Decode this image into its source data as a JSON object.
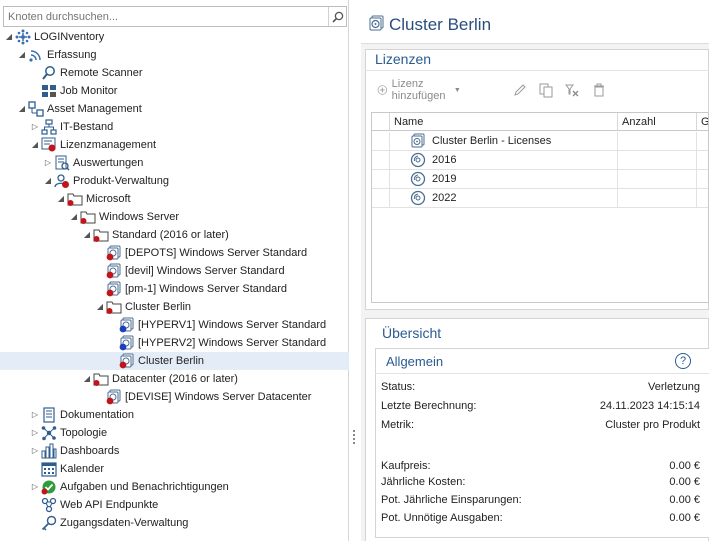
{
  "search": {
    "placeholder": "Knoten durchsuchen..."
  },
  "tree": [
    {
      "label": "LOGINventory",
      "toggle": "expanded",
      "icon": "loginventory-icon"
    },
    {
      "label": "Erfassung",
      "toggle": "expanded",
      "icon": "wifi-icon"
    },
    {
      "label": "Remote Scanner",
      "toggle": "",
      "icon": "magnifier-icon"
    },
    {
      "label": "Job Monitor",
      "toggle": "",
      "icon": "job-monitor-icon"
    },
    {
      "label": "Asset Management",
      "toggle": "expanded",
      "icon": "asset-management-icon"
    },
    {
      "label": "IT-Bestand",
      "toggle": "collapsed",
      "icon": "network-icon"
    },
    {
      "label": "Lizenzmanagement",
      "toggle": "expanded",
      "icon": "license-management-icon"
    },
    {
      "label": "Auswertungen",
      "toggle": "collapsed",
      "icon": "report-icon"
    },
    {
      "label": "Produkt-Verwaltung",
      "toggle": "expanded",
      "icon": "product-management-icon"
    },
    {
      "label": "Microsoft",
      "toggle": "expanded",
      "icon": "folder-icon"
    },
    {
      "label": "Windows Server",
      "toggle": "expanded",
      "icon": "folder-icon"
    },
    {
      "label": "Standard (2016 or later)",
      "toggle": "expanded",
      "icon": "folder-icon"
    },
    {
      "label": "[DEPOTS] Windows Server Standard",
      "toggle": "",
      "icon": "license-red-icon"
    },
    {
      "label": "[devil] Windows Server Standard",
      "toggle": "",
      "icon": "license-red-icon"
    },
    {
      "label": "[pm-1] Windows Server Standard",
      "toggle": "",
      "icon": "license-red-icon"
    },
    {
      "label": "Cluster Berlin",
      "toggle": "expanded",
      "icon": "folder-icon"
    },
    {
      "label": "[HYPERV1] Windows Server Standard",
      "toggle": "",
      "icon": "license-blue-icon"
    },
    {
      "label": "[HYPERV2] Windows Server Standard",
      "toggle": "",
      "icon": "license-blue-icon"
    },
    {
      "label": "Cluster Berlin",
      "toggle": "",
      "icon": "license-red-icon"
    },
    {
      "label": "Datacenter (2016 or later)",
      "toggle": "expanded",
      "icon": "folder-icon"
    },
    {
      "label": "[DEVISE] Windows Server Datacenter",
      "toggle": "",
      "icon": "license-red-icon"
    },
    {
      "label": "Dokumentation",
      "toggle": "collapsed",
      "icon": "document-icon"
    },
    {
      "label": "Topologie",
      "toggle": "collapsed",
      "icon": "topology-icon"
    },
    {
      "label": "Dashboards",
      "toggle": "collapsed",
      "icon": "dashboard-icon"
    },
    {
      "label": "Kalender",
      "toggle": "",
      "icon": "calendar-icon"
    },
    {
      "label": "Aufgaben und Benachrichtigungen",
      "toggle": "collapsed",
      "icon": "tasks-icon"
    },
    {
      "label": "Web API Endpunkte",
      "toggle": "",
      "icon": "web-api-icon"
    },
    {
      "label": "Zugangsdaten-Verwaltung",
      "toggle": "",
      "icon": "key-icon"
    }
  ],
  "header": {
    "title": "Cluster Berlin"
  },
  "licenses": {
    "title": "Lizenzen",
    "add_label": "Lizenz hinzufügen",
    "columns": [
      "Name",
      "Anzahl",
      "Gü"
    ],
    "rows": [
      {
        "name": "Cluster Berlin - Licenses",
        "icon": "license-group-icon"
      },
      {
        "name": "2016",
        "icon": "disc-icon"
      },
      {
        "name": "2019",
        "icon": "disc-icon"
      },
      {
        "name": "2022",
        "icon": "disc-icon"
      }
    ]
  },
  "overview": {
    "title": "Übersicht",
    "section": "Allgemein",
    "help": "?",
    "items": [
      {
        "key": "Status:",
        "value": "Verletzung"
      },
      {
        "key": "Letzte Berechnung:",
        "value": "24.11.2023 14:15:14"
      },
      {
        "key": "Metrik:",
        "value": "Cluster pro Produkt"
      }
    ],
    "costs": [
      {
        "key": "Kaufpreis:",
        "value": "0.00 €"
      },
      {
        "key": "Jährliche Kosten:",
        "value": "0.00 €"
      },
      {
        "key": "Pot. Jährliche Einsparungen:",
        "value": "0.00 €"
      },
      {
        "key": "Pot. Unnötige Ausgaben:",
        "value": "0.00 €"
      }
    ]
  }
}
